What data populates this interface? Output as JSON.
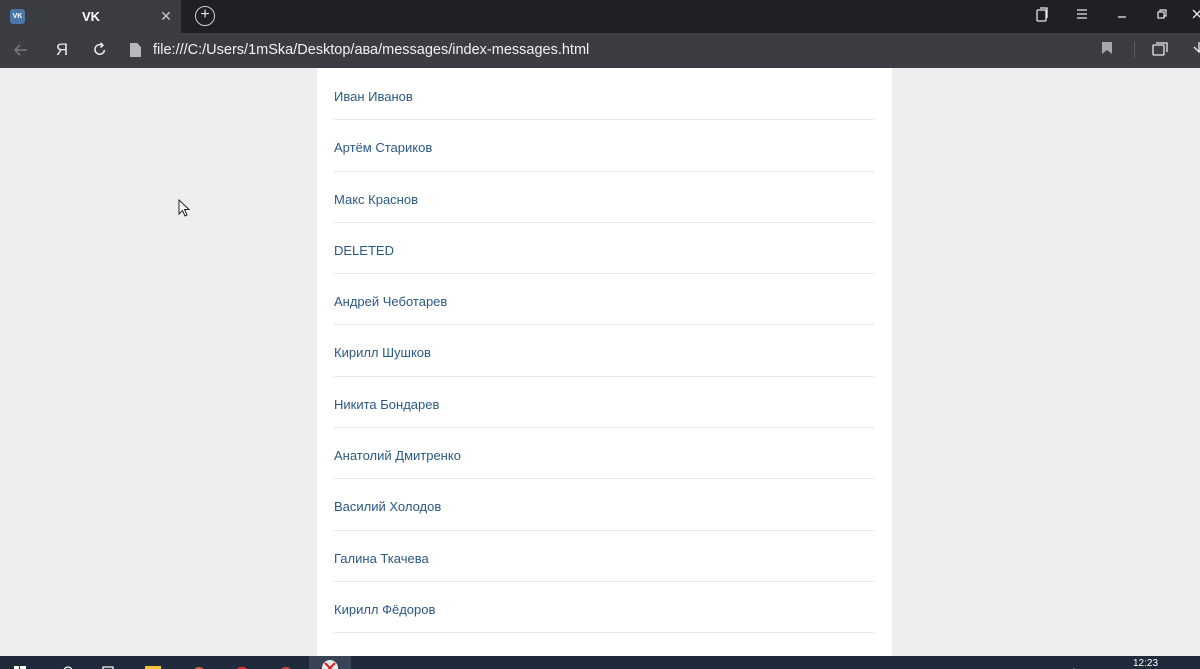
{
  "browser": {
    "tab": {
      "favicon": "VK",
      "title": "VK"
    },
    "new_tab_label": "+",
    "address": "file:///C:/Users/1mSka/Desktop/ава/messages/index-messages.html",
    "yandex_label": "Я",
    "icons": {
      "back": "back-arrow-icon",
      "reload": "reload-icon",
      "file": "file-icon",
      "bookmark": "bookmark-icon",
      "collections": "collections-icon",
      "downloads": "downloads-icon",
      "menu": "hamburger-menu-icon"
    }
  },
  "contacts": [
    "Иван Иванов",
    "Артём Стариков",
    "Макс Краснов",
    "DELETED",
    "Андрей Чеботарев",
    "Кирилл Шушков",
    "Никита Бондарев",
    "Анатолий Дмитренко",
    "Василий Холодов",
    "Галина Ткачева",
    "Кирилл Фёдоров"
  ],
  "taskbar": {
    "clock": "12:23"
  },
  "colors": {
    "link": "#2a5885",
    "page_bg": "#edeef0",
    "card_bg": "#ffffff",
    "chrome_dark": "#1f1f24",
    "chrome_bar": "#3c3c42"
  }
}
